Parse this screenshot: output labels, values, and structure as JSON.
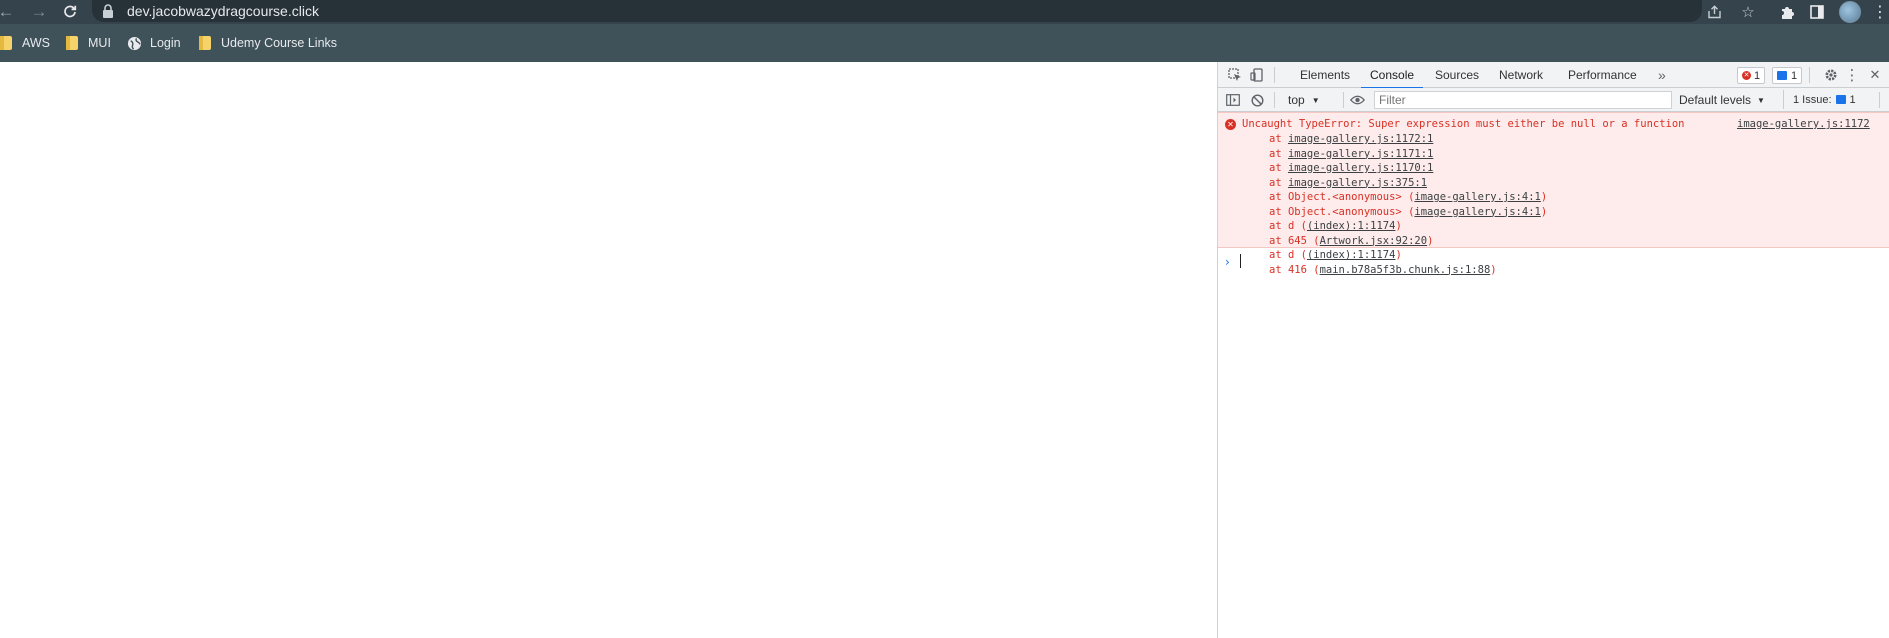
{
  "browser": {
    "url": "dev.jacobwazydragcourse.click",
    "bookmarks": [
      {
        "label": "AWS",
        "icon": "folder-icon"
      },
      {
        "label": "MUI",
        "icon": "folder-icon"
      },
      {
        "label": "Login",
        "icon": "globe-icon"
      },
      {
        "label": "Udemy Course Links",
        "icon": "folder-icon"
      }
    ]
  },
  "devtools": {
    "tabs": [
      {
        "label": "Elements"
      },
      {
        "label": "Console",
        "active": true
      },
      {
        "label": "Sources"
      },
      {
        "label": "Network"
      },
      {
        "label": "Performance"
      }
    ],
    "overflow_label": "»",
    "error_count": "1",
    "message_count": "1",
    "toolbar": {
      "context": "top",
      "filter_placeholder": "Filter",
      "levels": "Default levels",
      "issues_label": "1 Issue:",
      "issues_count": "1"
    },
    "console": {
      "error_message": "Uncaught TypeError: Super expression must either be null or a function",
      "error_source": "image-gallery.js:1172",
      "stack": [
        {
          "prefix": "at ",
          "fn": "",
          "link": "image-gallery.js:1172:1"
        },
        {
          "prefix": "at ",
          "fn": "",
          "link": "image-gallery.js:1171:1"
        },
        {
          "prefix": "at ",
          "fn": "",
          "link": "image-gallery.js:1170:1"
        },
        {
          "prefix": "at ",
          "fn": "",
          "link": "image-gallery.js:375:1"
        },
        {
          "prefix": "at ",
          "fn": "Object.<anonymous> ",
          "link": "image-gallery.js:4:1"
        },
        {
          "prefix": "at ",
          "fn": "Object.<anonymous> ",
          "link": "image-gallery.js:4:1"
        },
        {
          "prefix": "at ",
          "fn": "d ",
          "link": "(index):1:1174"
        },
        {
          "prefix": "at ",
          "fn": "645 ",
          "link": "Artwork.jsx:92:20"
        },
        {
          "prefix": "at ",
          "fn": "d ",
          "link": "(index):1:1174"
        },
        {
          "prefix": "at ",
          "fn": "416 ",
          "link": "main.b78a5f3b.chunk.js:1:88"
        }
      ],
      "prompt_symbol": "›"
    }
  },
  "colors": {
    "chrome_top": "#35434c",
    "bookmarks_bar": "#3f5159",
    "error_red": "#d93025",
    "error_bg": "#fdeceb",
    "accent_blue": "#1a73e8"
  }
}
